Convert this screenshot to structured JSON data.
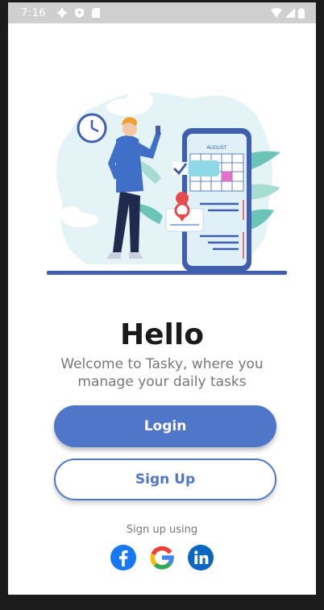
{
  "status_bar": {
    "time": "7:16",
    "icons_left": [
      "gear-icon",
      "shield-icon",
      "sd-card-icon"
    ],
    "icons_right": [
      "wifi-icon",
      "signal-icon",
      "battery-icon"
    ]
  },
  "illustration": {
    "calendar_month": "AUGUST"
  },
  "welcome": {
    "title": "Hello",
    "subtitle_line1": "Welcome to Tasky, where you",
    "subtitle_line2": "manage your daily tasks"
  },
  "actions": {
    "login_label": "Login",
    "signup_label": "Sign Up"
  },
  "social": {
    "prompt": "Sign up using",
    "providers": [
      "facebook-icon",
      "google-icon",
      "linkedin-icon"
    ]
  },
  "colors": {
    "primary": "#4f76c9",
    "status_bar": "#cfcfcf",
    "facebook": "#1877f2",
    "linkedin": "#0a66c2"
  }
}
